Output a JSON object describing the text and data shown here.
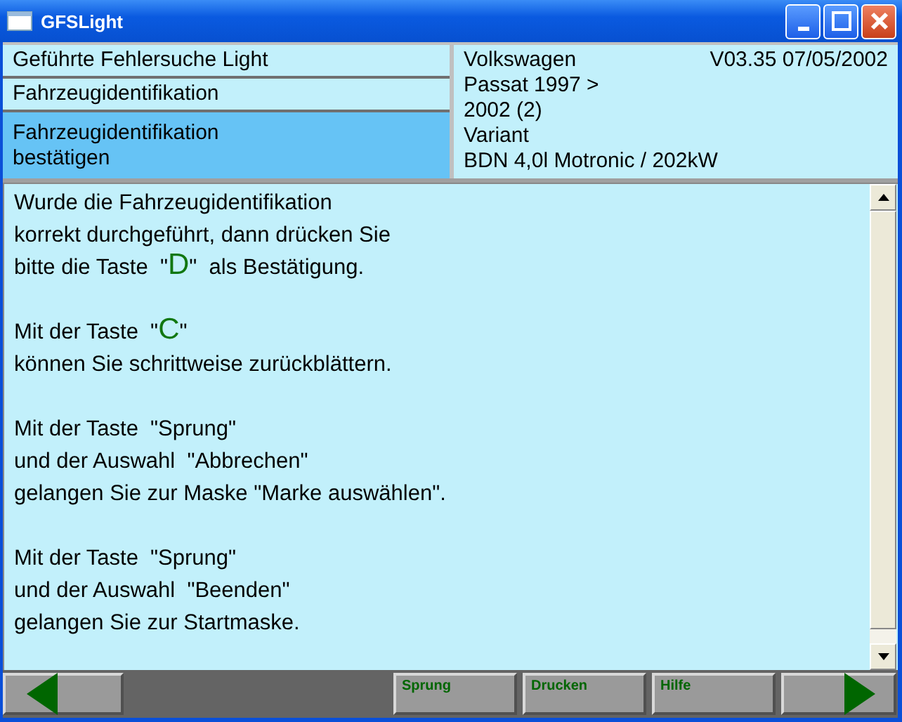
{
  "window": {
    "title": "GFSLight"
  },
  "steps": [
    {
      "label": "Geführte Fehlersuche Light",
      "selected": false
    },
    {
      "label": "Fahrzeugidentifikation",
      "selected": false
    },
    {
      "label": "Fahrzeugidentifikation\nbestätigen",
      "selected": true
    }
  ],
  "vehicle": {
    "make": "Volkswagen",
    "version": "V03.35 07/05/2002",
    "lines": [
      "Passat 1997 >",
      "2002 (2)",
      "Variant",
      "BDN 4,0l Motronic / 202kW"
    ]
  },
  "message": [
    [
      [
        {
          "text": "Wurde die Fahrzeugidentifikation"
        }
      ],
      [
        {
          "text": "korrekt durchgeführt, dann drücken Sie"
        }
      ],
      [
        {
          "text": "bitte die Taste  \""
        },
        {
          "text": "D",
          "kind": "key"
        },
        {
          "text": "\"  als Bestätigung."
        }
      ]
    ],
    [
      [
        {
          "text": "Mit der Taste  \""
        },
        {
          "text": "C",
          "kind": "key"
        },
        {
          "text": "\""
        }
      ],
      [
        {
          "text": "können Sie schrittweise zurückblättern."
        }
      ]
    ],
    [
      [
        {
          "text": "Mit der Taste  \"Sprung\""
        }
      ],
      [
        {
          "text": "und der Auswahl  \"Abbrechen\""
        }
      ],
      [
        {
          "text": "gelangen Sie zur Maske \"Marke auswählen\"."
        }
      ]
    ],
    [
      [
        {
          "text": "Mit der Taste  \"Sprung\""
        }
      ],
      [
        {
          "text": "und der Auswahl  \"Beenden\""
        }
      ],
      [
        {
          "text": "gelangen Sie zur Startmaske."
        }
      ]
    ]
  ],
  "buttons": [
    "Sprung",
    "Drucken",
    "Hilfe"
  ]
}
